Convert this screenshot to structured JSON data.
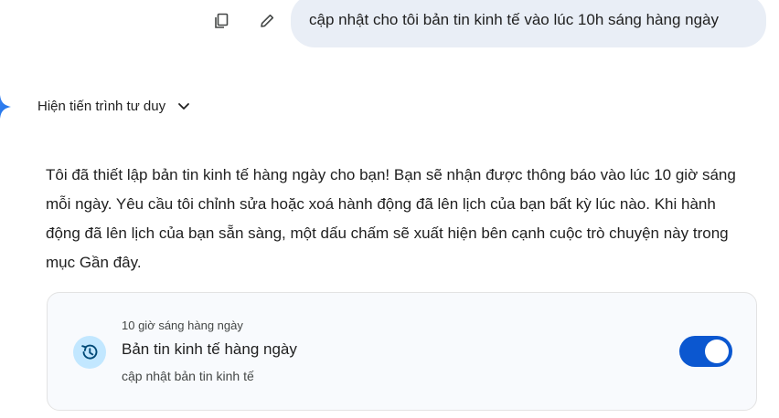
{
  "user_message": "cập nhật cho tôi bản tin kinh tế vào lúc 10h sáng hàng ngày",
  "thinking_toggle": {
    "label": "Hiện tiến trình tư duy"
  },
  "response": {
    "text": "Tôi đã thiết lập bản tin kinh tế hàng ngày cho bạn! Bạn sẽ nhận được thông báo vào lúc 10 giờ sáng mỗi ngày. Yêu cầu tôi chỉnh sửa hoặc xoá hành động đã lên lịch của bạn bất kỳ lúc nào. Khi hành động đã lên lịch của bạn sẵn sàng, một dấu chấm sẽ xuất hiện bên cạnh cuộc trò chuyện này trong mục Gần đây."
  },
  "scheduled_card": {
    "time": "10 giờ sáng hàng ngày",
    "title": "Bản tin kinh tế hàng ngày",
    "subtitle": "cập nhật bản tin kinh tế",
    "enabled": true,
    "icon": "schedule-history-icon"
  },
  "icons": {
    "copy": "copy-icon",
    "edit": "pencil-icon",
    "assistant": "sparkle-icon",
    "chevron": "chevron-down-icon"
  },
  "colors": {
    "bubble": "#e9eef6",
    "toggle_on": "#0b57d0",
    "avatar_bg": "#c2e7ff",
    "card_bg": "#f8fafd"
  }
}
